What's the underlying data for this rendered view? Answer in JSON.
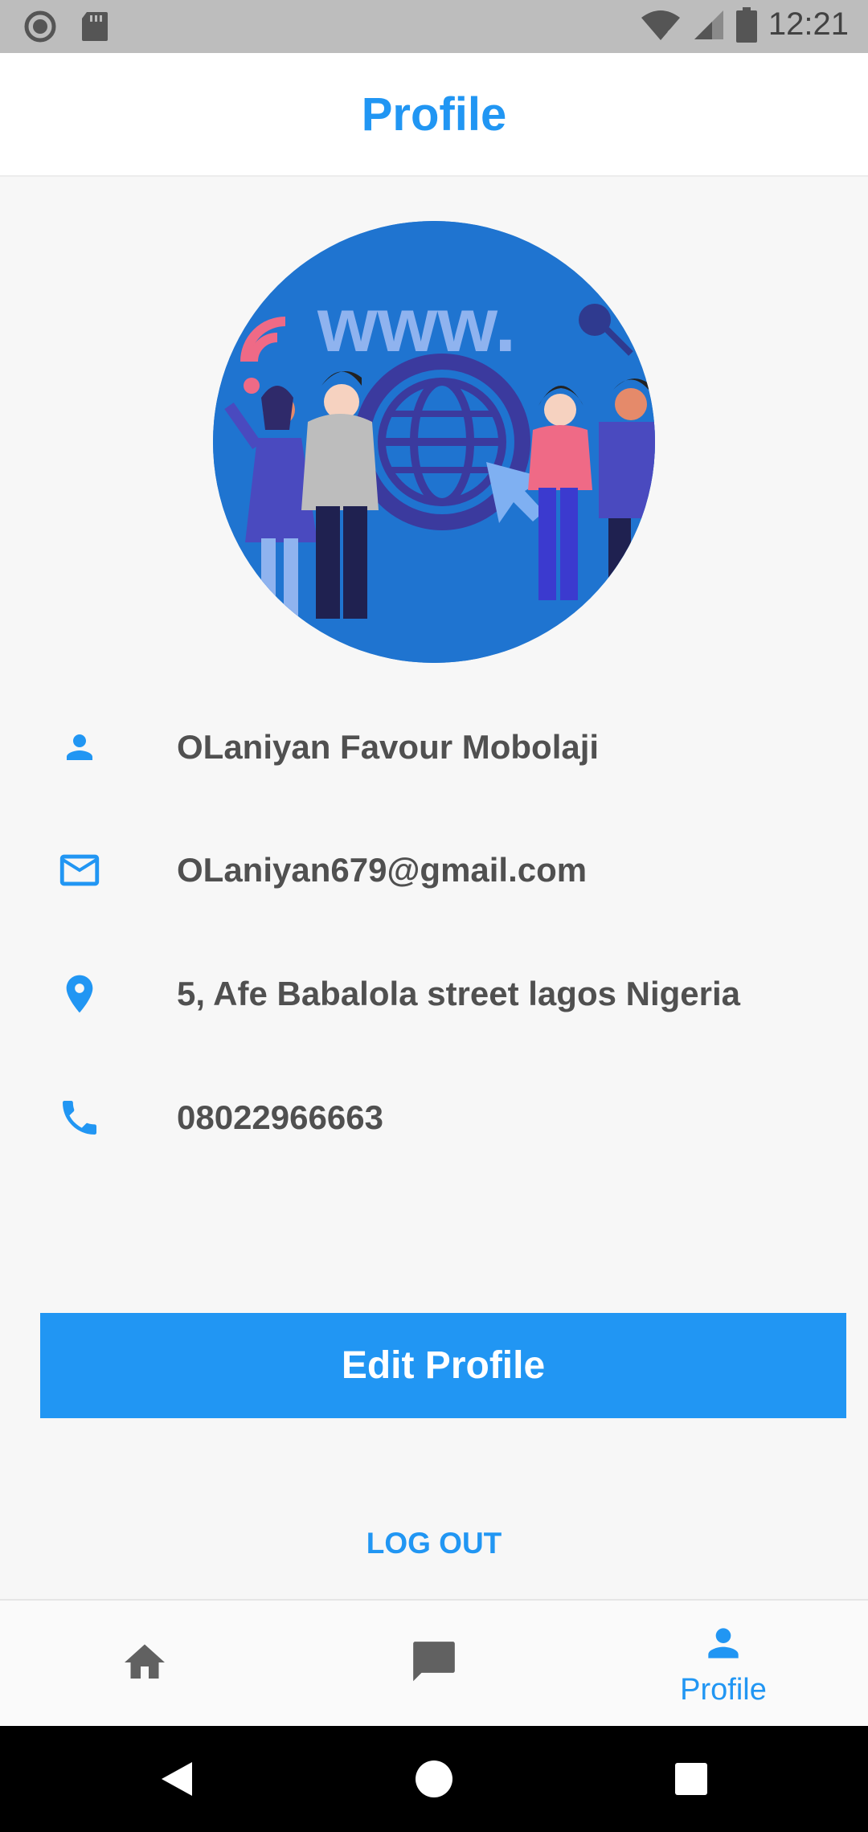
{
  "status_bar": {
    "time": "12:21",
    "icons": [
      "record-icon",
      "sd-card-icon",
      "wifi-icon",
      "signal-icon",
      "battery-icon"
    ]
  },
  "header": {
    "title": "Profile"
  },
  "avatar": {
    "alt_icon": "www-people-illustration",
    "watermark_text": "www."
  },
  "profile": {
    "name": "OLaniyan Favour Mobolaji",
    "email": "OLaniyan679@gmail.com",
    "address": "5, Afe Babalola street lagos Nigeria",
    "phone": "08022966663"
  },
  "actions": {
    "edit_label": "Edit Profile",
    "logout_label": "LOG OUT"
  },
  "bottom_nav": {
    "items": [
      {
        "icon": "home-icon",
        "label": ""
      },
      {
        "icon": "chat-icon",
        "label": ""
      },
      {
        "icon": "person-icon",
        "label": "Profile",
        "active": true
      }
    ]
  },
  "colors": {
    "accent": "#2196f3",
    "text": "#505050",
    "status_bar": "#bdbdbd",
    "inactive_icon": "#616161"
  }
}
